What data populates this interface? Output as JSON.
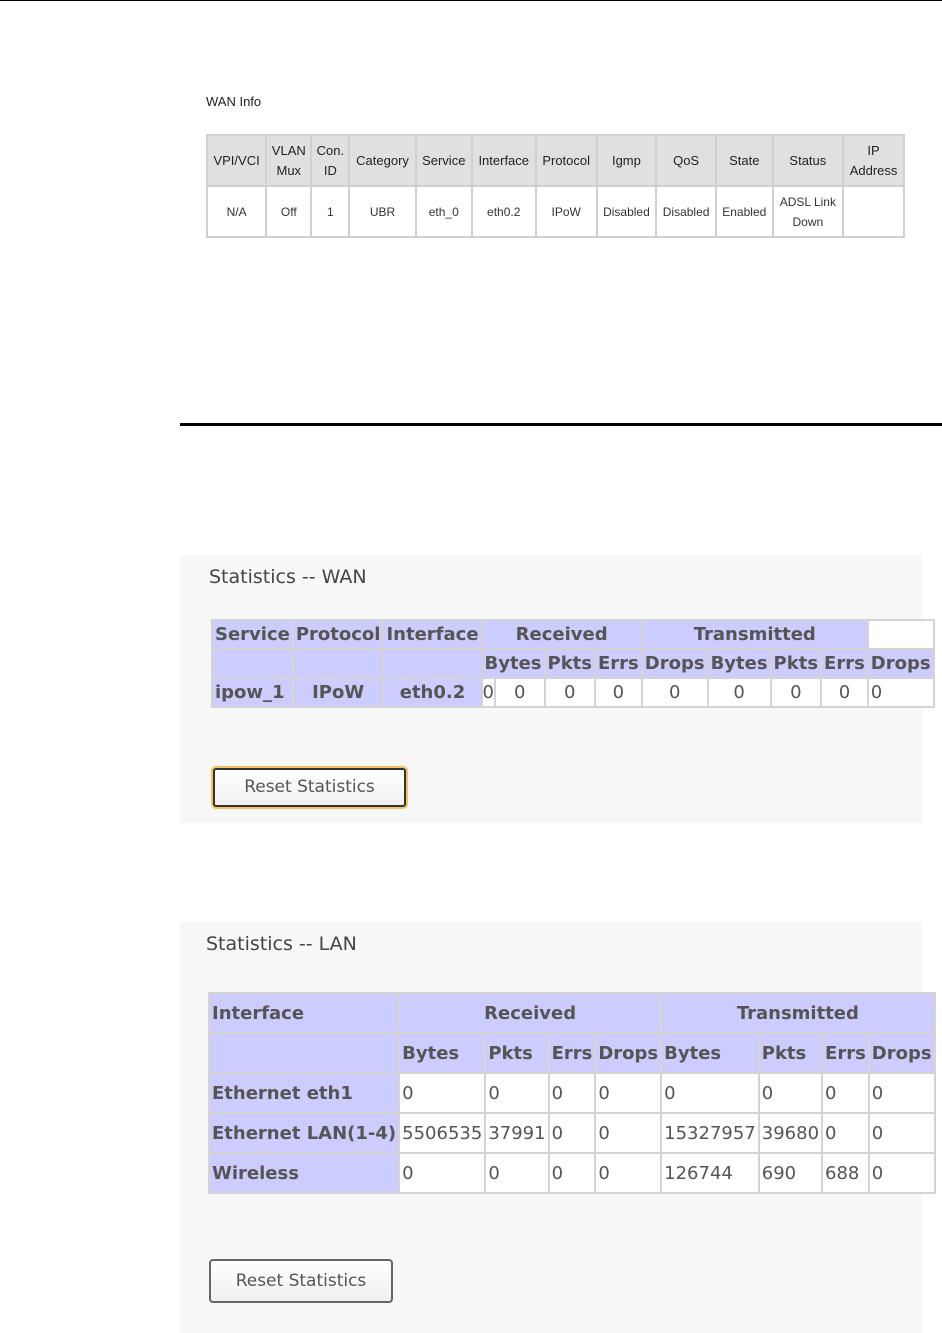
{
  "wan_info": {
    "title": "WAN Info",
    "headers": [
      [
        "VPI/VCI"
      ],
      [
        "VLAN",
        "Mux"
      ],
      [
        "Con.",
        "ID"
      ],
      [
        "Category"
      ],
      [
        "Service"
      ],
      [
        "Interface"
      ],
      [
        "Protocol"
      ],
      [
        "Igmp"
      ],
      [
        "QoS"
      ],
      [
        "State"
      ],
      [
        "Status"
      ],
      [
        "IP",
        "Address"
      ]
    ],
    "row": [
      [
        "N/A"
      ],
      [
        "Off"
      ],
      [
        "1"
      ],
      [
        "UBR"
      ],
      [
        "eth_0"
      ],
      [
        "eth0.2"
      ],
      [
        "IPoW"
      ],
      [
        "Disabled"
      ],
      [
        "Disabled"
      ],
      [
        "Enabled"
      ],
      [
        "ADSL Link",
        "Down"
      ],
      [
        ""
      ]
    ]
  },
  "wan_stats": {
    "title": "Statistics -- WAN",
    "headers": {
      "service": "Service",
      "protocol": "Protocol",
      "interface": "Interface",
      "received": "Received",
      "transmitted": "Transmitted"
    },
    "subheaders": [
      "Bytes",
      "Pkts",
      "Errs",
      "Drops",
      "Bytes",
      "Pkts",
      "Errs",
      "Drops"
    ],
    "row": {
      "service": "ipow_1",
      "protocol": "IPoW",
      "interface": "eth0.2",
      "values": [
        "0",
        "0",
        "0",
        "0",
        "0",
        "0",
        "0",
        "0",
        "0"
      ]
    },
    "reset_label": "Reset Statistics"
  },
  "lan_stats": {
    "title": "Statistics -- LAN",
    "headers": {
      "interface": "Interface",
      "received": "Received",
      "transmitted": "Transmitted"
    },
    "subheaders": [
      "Bytes",
      "Pkts",
      "Errs",
      "Drops",
      "Bytes",
      "Pkts",
      "Errs",
      "Drops"
    ],
    "rows": [
      {
        "name": "Ethernet eth1",
        "values": [
          "0",
          "0",
          "0",
          "0",
          "0",
          "0",
          "0",
          "0"
        ]
      },
      {
        "name": "Ethernet LAN(1-4)",
        "values": [
          "5506535",
          "37991",
          "0",
          "0",
          "15327957",
          "39680",
          "0",
          "0"
        ]
      },
      {
        "name": "Wireless",
        "values": [
          "0",
          "0",
          "0",
          "0",
          "126744",
          "690",
          "688",
          "0"
        ]
      }
    ],
    "reset_label": "Reset Statistics"
  }
}
